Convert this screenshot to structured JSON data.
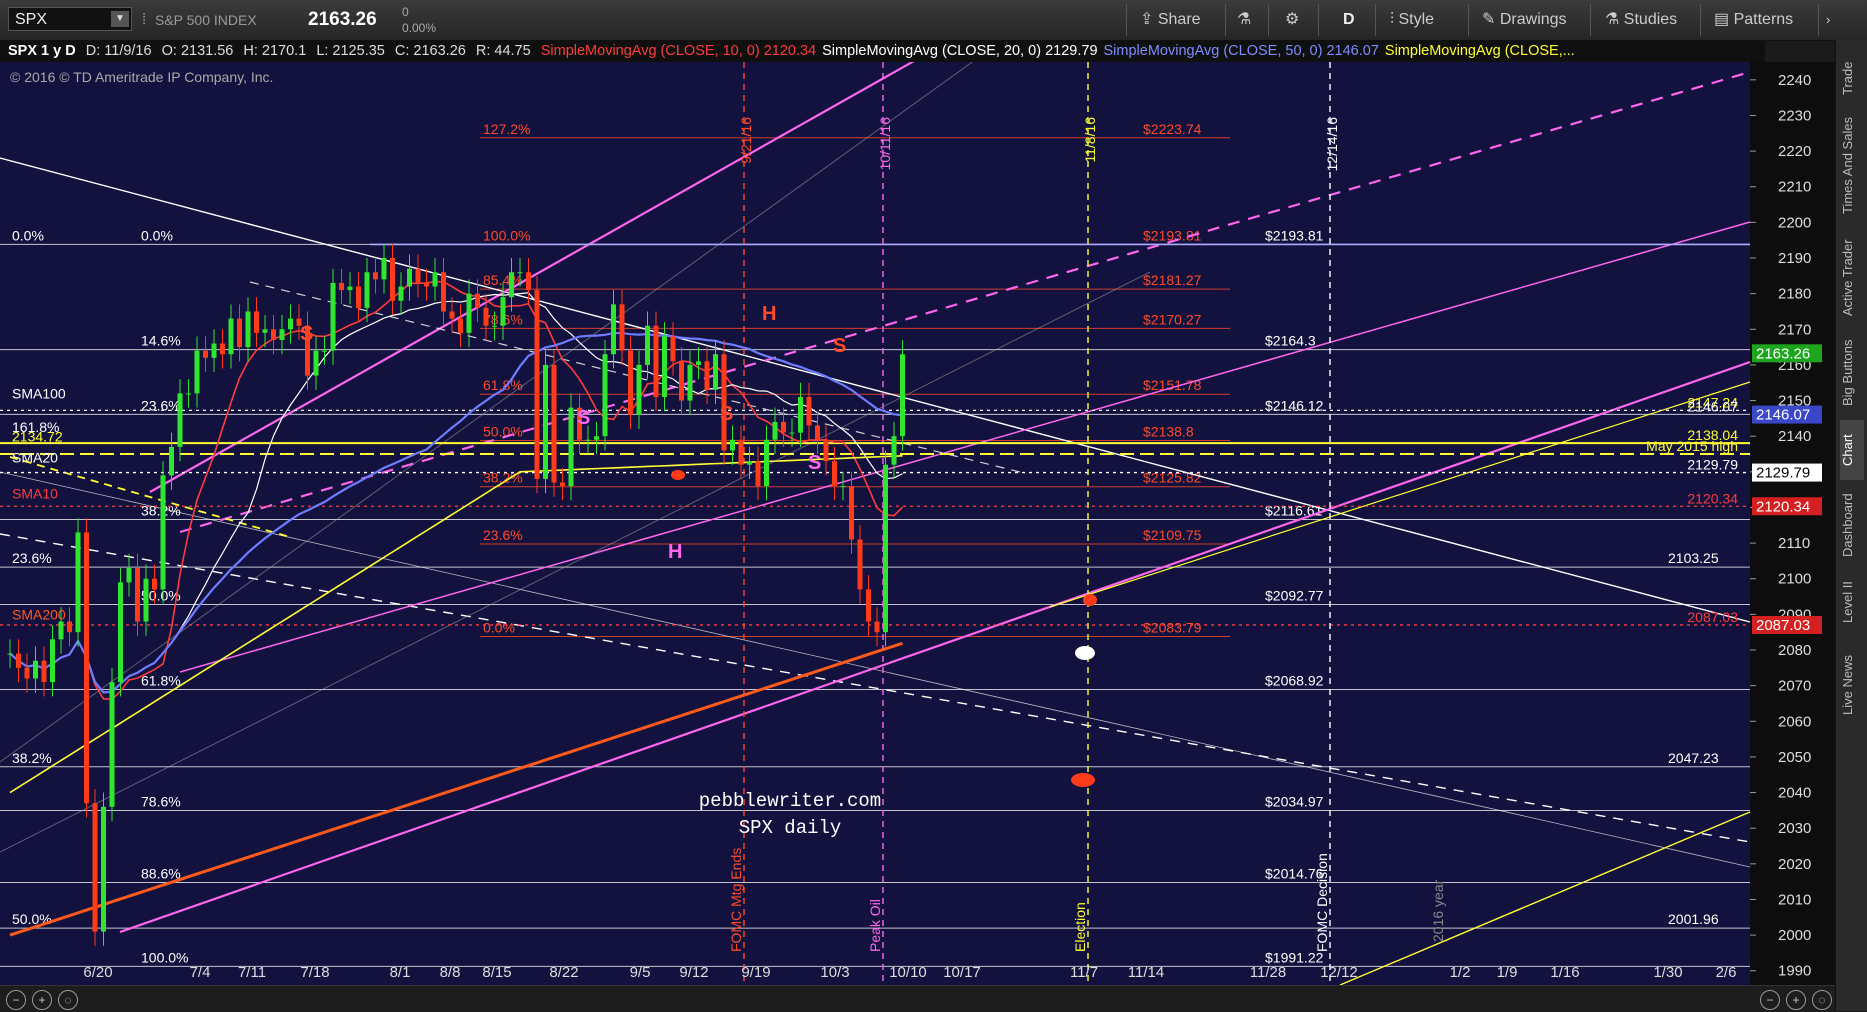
{
  "toolbar": {
    "symbol": "SPX",
    "index_name": "S&P 500 INDEX",
    "last_price": "2163.26",
    "change": "0",
    "change_pct": "0.00%",
    "share": "Share",
    "timeframe": "D",
    "style": "Style",
    "drawings": "Drawings",
    "studies": "Studies",
    "patterns": "Patterns"
  },
  "legend": {
    "symbol": "SPX 1 y D",
    "date": "D: 11/9/16",
    "open": "O: 2131.56",
    "high": "H: 2170.1",
    "low": "L: 2125.35",
    "close": "C: 2163.26",
    "range": "R: 44.75",
    "studies": [
      {
        "text": "SimpleMovingAvg (CLOSE, 10, 0)",
        "value": "2120.34",
        "color": "#ff3b3b"
      },
      {
        "text": "SimpleMovingAvg (CLOSE, 20, 0)",
        "value": "2129.79",
        "color": "#ffffff"
      },
      {
        "text": "SimpleMovingAvg (CLOSE, 50, 0)",
        "value": "2146.07",
        "color": "#7f8cff"
      },
      {
        "text": "SimpleMovingAvg (CLOSE,...",
        "value": "",
        "color": "#ffff33"
      }
    ]
  },
  "copyright": "© 2016 © TD Ameritrade IP Company, Inc.",
  "watermark": {
    "line1": "pebblewriter.com",
    "line2": "SPX daily"
  },
  "colors": {
    "background": "#13123e",
    "candle_up": "#2fe62f",
    "candle_down": "#ff3b19",
    "sma10": "#ff3b3b",
    "sma20": "#ffffff",
    "sma50": "#6f7cff",
    "sma200": "#ff5a1a",
    "fib_red": "#ff4a2a",
    "channel_magenta": "#ff66ee",
    "yellow": "#ffff33"
  },
  "chart_data": {
    "type": "candlestick",
    "ylim": [
      1986,
      2245
    ],
    "y_ticks": [
      1990,
      2000,
      2010,
      2020,
      2030,
      2040,
      2050,
      2060,
      2070,
      2080,
      2090,
      2100,
      2110,
      2120,
      2130,
      2140,
      2150,
      2160,
      2170,
      2180,
      2190,
      2200,
      2210,
      2220,
      2230,
      2240
    ],
    "x_ticks": [
      "6/20",
      "7/4",
      "7/11",
      "7/18",
      "8/1",
      "8/8",
      "8/15",
      "8/22",
      "9/5",
      "9/12",
      "9/19",
      "10/3",
      "10/10",
      "10/17",
      "11/7",
      "11/14",
      "11/28",
      "12/12",
      "1/2",
      "1/9",
      "1/16",
      "1/30",
      "2/6"
    ],
    "closes": [
      {
        "d": "6/13",
        "c": 2079
      },
      {
        "d": "6/14",
        "c": 2075
      },
      {
        "d": "6/15",
        "c": 2072
      },
      {
        "d": "6/16",
        "c": 2077
      },
      {
        "d": "6/17",
        "c": 2071
      },
      {
        "d": "6/20",
        "c": 2083
      },
      {
        "d": "6/21",
        "c": 2088
      },
      {
        "d": "6/22",
        "c": 2085
      },
      {
        "d": "6/23",
        "c": 2113
      },
      {
        "d": "6/24",
        "c": 2037
      },
      {
        "d": "6/27",
        "c": 2001
      },
      {
        "d": "6/28",
        "c": 2036
      },
      {
        "d": "6/29",
        "c": 2071
      },
      {
        "d": "6/30",
        "c": 2099
      },
      {
        "d": "7/1",
        "c": 2103
      },
      {
        "d": "7/5",
        "c": 2088
      },
      {
        "d": "7/6",
        "c": 2100
      },
      {
        "d": "7/7",
        "c": 2097
      },
      {
        "d": "7/8",
        "c": 2129
      },
      {
        "d": "7/11",
        "c": 2137
      },
      {
        "d": "7/12",
        "c": 2152
      },
      {
        "d": "7/13",
        "c": 2152
      },
      {
        "d": "7/14",
        "c": 2164
      },
      {
        "d": "7/15",
        "c": 2162
      },
      {
        "d": "7/18",
        "c": 2166
      },
      {
        "d": "7/19",
        "c": 2163
      },
      {
        "d": "7/20",
        "c": 2173
      },
      {
        "d": "7/21",
        "c": 2165
      },
      {
        "d": "7/22",
        "c": 2175
      },
      {
        "d": "7/25",
        "c": 2169
      },
      {
        "d": "7/26",
        "c": 2170
      },
      {
        "d": "7/27",
        "c": 2167
      },
      {
        "d": "7/28",
        "c": 2170
      },
      {
        "d": "7/29",
        "c": 2173
      },
      {
        "d": "8/1",
        "c": 2171
      },
      {
        "d": "8/2",
        "c": 2157
      },
      {
        "d": "8/3",
        "c": 2164
      },
      {
        "d": "8/4",
        "c": 2164
      },
      {
        "d": "8/5",
        "c": 2183
      },
      {
        "d": "8/8",
        "c": 2181
      },
      {
        "d": "8/9",
        "c": 2182
      },
      {
        "d": "8/10",
        "c": 2176
      },
      {
        "d": "8/11",
        "c": 2186
      },
      {
        "d": "8/12",
        "c": 2184
      },
      {
        "d": "8/15",
        "c": 2190
      },
      {
        "d": "8/16",
        "c": 2178
      },
      {
        "d": "8/17",
        "c": 2182
      },
      {
        "d": "8/18",
        "c": 2187
      },
      {
        "d": "8/19",
        "c": 2183
      },
      {
        "d": "8/22",
        "c": 2182
      },
      {
        "d": "8/23",
        "c": 2186
      },
      {
        "d": "8/24",
        "c": 2175
      },
      {
        "d": "8/25",
        "c": 2173
      },
      {
        "d": "8/26",
        "c": 2169
      },
      {
        "d": "8/29",
        "c": 2180
      },
      {
        "d": "8/30",
        "c": 2176
      },
      {
        "d": "8/31",
        "c": 2171
      },
      {
        "d": "9/1",
        "c": 2171
      },
      {
        "d": "9/2",
        "c": 2179
      },
      {
        "d": "9/6",
        "c": 2186
      },
      {
        "d": "9/7",
        "c": 2186
      },
      {
        "d": "9/8",
        "c": 2181
      },
      {
        "d": "9/9",
        "c": 2128
      },
      {
        "d": "9/12",
        "c": 2160
      },
      {
        "d": "9/13",
        "c": 2127
      },
      {
        "d": "9/14",
        "c": 2126
      },
      {
        "d": "9/15",
        "c": 2148
      },
      {
        "d": "9/16",
        "c": 2139
      },
      {
        "d": "9/19",
        "c": 2139
      },
      {
        "d": "9/20",
        "c": 2140
      },
      {
        "d": "9/21",
        "c": 2163
      },
      {
        "d": "9/22",
        "c": 2177
      },
      {
        "d": "9/23",
        "c": 2164
      },
      {
        "d": "9/26",
        "c": 2146
      },
      {
        "d": "9/27",
        "c": 2160
      },
      {
        "d": "9/28",
        "c": 2171
      },
      {
        "d": "9/29",
        "c": 2151
      },
      {
        "d": "9/30",
        "c": 2168
      },
      {
        "d": "10/3",
        "c": 2161
      },
      {
        "d": "10/4",
        "c": 2150
      },
      {
        "d": "10/5",
        "c": 2160
      },
      {
        "d": "10/6",
        "c": 2161
      },
      {
        "d": "10/7",
        "c": 2153
      },
      {
        "d": "10/10",
        "c": 2163
      },
      {
        "d": "10/11",
        "c": 2136
      },
      {
        "d": "10/12",
        "c": 2139
      },
      {
        "d": "10/13",
        "c": 2132
      },
      {
        "d": "10/14",
        "c": 2133
      },
      {
        "d": "10/17",
        "c": 2126
      },
      {
        "d": "10/18",
        "c": 2139
      },
      {
        "d": "10/19",
        "c": 2144
      },
      {
        "d": "10/20",
        "c": 2141
      },
      {
        "d": "10/21",
        "c": 2141
      },
      {
        "d": "10/24",
        "c": 2151
      },
      {
        "d": "10/25",
        "c": 2143
      },
      {
        "d": "10/26",
        "c": 2139
      },
      {
        "d": "10/27",
        "c": 2133
      },
      {
        "d": "10/28",
        "c": 2126
      },
      {
        "d": "10/31",
        "c": 2126
      },
      {
        "d": "11/1",
        "c": 2111
      },
      {
        "d": "11/2",
        "c": 2097
      },
      {
        "d": "11/3",
        "c": 2088
      },
      {
        "d": "11/4",
        "c": 2085
      },
      {
        "d": "11/7",
        "c": 2132
      },
      {
        "d": "11/8",
        "c": 2140
      },
      {
        "d": "11/9",
        "c": 2163
      }
    ],
    "horizontal_levels": [
      {
        "value": 2193.81,
        "label": "$2193.81",
        "color": "#ffffff"
      },
      {
        "value": 2164.3,
        "label": "$2164.3",
        "color": "#ffffff"
      },
      {
        "value": 2146.12,
        "label": "$2146.12",
        "color": "#ffffff"
      },
      {
        "value": 2116.61,
        "label": "$2116.61",
        "color": "#ffffff"
      },
      {
        "value": 2103.25,
        "label": "2103.25",
        "color": "#ffffff"
      },
      {
        "value": 2092.77,
        "label": "$2092.77",
        "color": "#ffffff"
      },
      {
        "value": 2068.92,
        "label": "$2068.92",
        "color": "#ffffff"
      },
      {
        "value": 2047.23,
        "label": "2047.23",
        "color": "#ffffff"
      },
      {
        "value": 2034.97,
        "label": "$2034.97",
        "color": "#ffffff"
      },
      {
        "value": 2014.76,
        "label": "$2014.76",
        "color": "#ffffff"
      },
      {
        "value": 2001.96,
        "label": "2001.96",
        "color": "#ffffff"
      },
      {
        "value": 1991.22,
        "label": "$1991.22",
        "color": "#ffffff"
      }
    ],
    "fib_levels_red": [
      {
        "value": 2223.74,
        "label": "$2223.74",
        "pct": "127.2%"
      },
      {
        "value": 2193.81,
        "label": "$2193.81",
        "pct": "100.0%"
      },
      {
        "value": 2181.27,
        "label": "$2181.27",
        "pct": "85.4%"
      },
      {
        "value": 2170.27,
        "label": "$2170.27",
        "pct": "78.6%"
      },
      {
        "value": 2151.78,
        "label": "$2151.78",
        "pct": "61.8%"
      },
      {
        "value": 2138.8,
        "label": "$2138.8",
        "pct": "50.0%"
      },
      {
        "value": 2125.82,
        "label": "$2125.82",
        "pct": "38.2%"
      },
      {
        "value": 2109.75,
        "label": "$2109.75",
        "pct": "23.6%"
      },
      {
        "value": 2083.79,
        "label": "$2083.79",
        "pct": "0.0%"
      }
    ],
    "left_fib_labels": [
      {
        "value": 2193.81,
        "label": "0.0%",
        "x": "a"
      },
      {
        "value": 2193.81,
        "label": "0.0%",
        "x": "b"
      },
      {
        "value": 2164.3,
        "label": "14.6%",
        "x": "b"
      },
      {
        "value": 2146.12,
        "label": "23.6%",
        "x": "b"
      },
      {
        "value": 2140,
        "label": "161.8%",
        "x": "a"
      },
      {
        "value": 2116.61,
        "label": "38.2%",
        "x": "b"
      },
      {
        "value": 2103.25,
        "label": "23.6%",
        "x": "a"
      },
      {
        "value": 2092.77,
        "label": "50.0%",
        "x": "b"
      },
      {
        "value": 2068.92,
        "label": "61.8%",
        "x": "b"
      },
      {
        "value": 2047.23,
        "label": "38.2%",
        "x": "a"
      },
      {
        "value": 2034.97,
        "label": "78.6%",
        "x": "b"
      },
      {
        "value": 2014.76,
        "label": "88.6%",
        "x": "b"
      },
      {
        "value": 2001.96,
        "label": "50.0%",
        "x": "a"
      },
      {
        "value": 1991.22,
        "label": "100.0%",
        "x": "b"
      }
    ],
    "right_labels": [
      {
        "value": 2147.24,
        "label": "2147.24",
        "color": "#ffff33"
      },
      {
        "value": 2146.07,
        "label": "2146.07",
        "color": "#ffffff",
        "bg": "#3a47c9"
      },
      {
        "value": 2138.04,
        "label": "2138.04",
        "color": "#ffff33"
      },
      {
        "value": 2135,
        "label": "May 2015 high",
        "color": "#ffff33"
      },
      {
        "value": 2129.79,
        "label": "2129.79",
        "color": "#ffffff"
      },
      {
        "value": 2120.34,
        "label": "2120.34",
        "color": "#ff3b3b"
      },
      {
        "value": 2087.03,
        "label": "2087.03",
        "color": "#ff3b3b"
      }
    ],
    "price_tags": [
      {
        "value": 2163.26,
        "label": "2163.26",
        "bg": "#1ea51e"
      },
      {
        "value": 2146.07,
        "label": "2146.07",
        "bg": "#3a47c9"
      },
      {
        "value": 2129.79,
        "label": "2129.79",
        "bg": "#ffffff",
        "fg": "#000"
      },
      {
        "value": 2120.34,
        "label": "2120.34",
        "bg": "#d42020"
      },
      {
        "value": 2087.03,
        "label": "2087.03",
        "bg": "#d42020"
      }
    ],
    "sma_labels": [
      {
        "label": "SMA100",
        "value": 2150
      },
      {
        "label": "SMA20",
        "value": 2132
      },
      {
        "label": "SMA10",
        "value": 2122
      },
      {
        "label": "SMA200",
        "value": 2088
      }
    ],
    "vertical_events": [
      {
        "date": "9/21/16",
        "label": "FOMC Mtg Ends",
        "color": "#ff4a2a"
      },
      {
        "date": "10/11/16",
        "label": "Peak Oil",
        "color": "#ff66ee"
      },
      {
        "date": "11/8/16",
        "label": "Election",
        "color": "#ffff33"
      },
      {
        "date": "12/14/16",
        "label": "FOMC Decision",
        "color": "#ffffff"
      }
    ],
    "pattern_labels": [
      {
        "text": "S",
        "color": "#ff4a2a"
      },
      {
        "text": "H",
        "color": "#ff4a2a"
      },
      {
        "text": "S",
        "color": "#ff4a2a"
      },
      {
        "text": "S",
        "color": "#ff4a2a"
      },
      {
        "text": "S",
        "color": "#ff66ee"
      },
      {
        "text": "S",
        "color": "#ff66ee"
      },
      {
        "text": "H",
        "color": "#ff66ee"
      }
    ],
    "extra_text": {
      "year_label": "2016 year",
      "left_price": "2134.72"
    }
  },
  "side_tabs": [
    "Trade",
    "Times And Sales",
    "Active Trader",
    "Big Buttons",
    "Chart",
    "Dashboard",
    "Level II",
    "Live News"
  ]
}
